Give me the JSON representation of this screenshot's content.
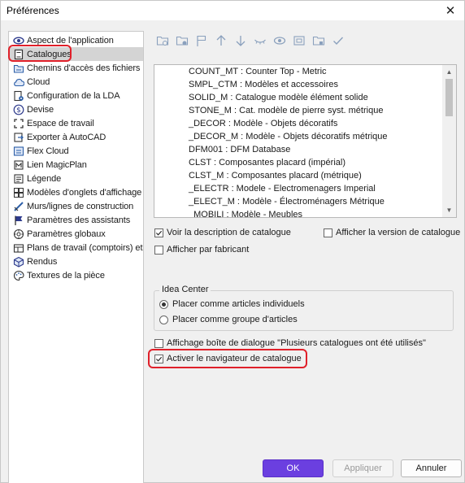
{
  "window": {
    "title": "Préférences",
    "close_glyph": "✕"
  },
  "sidebar": {
    "items": [
      {
        "label": "Aspect de l'application",
        "icon": "eye-icon"
      },
      {
        "label": "Catalogues",
        "icon": "book-icon",
        "selected": true
      },
      {
        "label": "Chemins d'accès des fichiers",
        "icon": "folder-path-icon"
      },
      {
        "label": "Cloud",
        "icon": "cloud-icon"
      },
      {
        "label": "Configuration de la LDA",
        "icon": "config-icon"
      },
      {
        "label": "Devise",
        "icon": "currency-icon"
      },
      {
        "label": "Espace de travail",
        "icon": "workspace-icon"
      },
      {
        "label": "Exporter à AutoCAD",
        "icon": "export-icon"
      },
      {
        "label": "Flex Cloud",
        "icon": "flex-cloud-icon"
      },
      {
        "label": "Lien MagicPlan",
        "icon": "link-icon"
      },
      {
        "label": "Légende",
        "icon": "legend-icon"
      },
      {
        "label": "Modèles d'onglets d'affichage",
        "icon": "tabs-icon"
      },
      {
        "label": "Murs/lignes de construction",
        "icon": "walls-icon"
      },
      {
        "label": "Paramètres des assistants",
        "icon": "flag-icon"
      },
      {
        "label": "Paramètres globaux",
        "icon": "globe-icon"
      },
      {
        "label": "Plans de travail (comptoirs) et g",
        "icon": "countertop-icon"
      },
      {
        "label": "Rendus",
        "icon": "render-icon"
      },
      {
        "label": "Textures de la pièce",
        "icon": "palette-icon"
      }
    ]
  },
  "toolbar": {
    "icons": [
      "add-folder-icon",
      "folder-settings-icon",
      "flag-icon",
      "arrow-up-icon",
      "arrow-down-icon",
      "eye-closed-icon",
      "eye-icon",
      "window-icon",
      "folder-gear-icon",
      "check-icon"
    ]
  },
  "catalog_list": {
    "rows": [
      "COUNT_MT : Counter Top - Metric",
      "SMPL_CTM : Modèles et accessoires",
      "SOLID_M : Catalogue modèle élément solide",
      "STONE_M : Cat. modèle de pierre syst. métrique",
      "_DECOR : Modèle - Objets décoratifs",
      "_DECOR_M : Modèle - Objets décoratifs métrique",
      "DFM001 : DFM Database",
      "CLST : Composantes placard (impérial)",
      "CLST_M : Composantes placard (métrique)",
      "_ELECTR : Modele - Electromenagers Imperial",
      "_ELECT_M : Modèle - Électroménagers Métrique",
      "_MOBILI : Modèle - Meubles"
    ]
  },
  "options": {
    "show_description": {
      "label": "Voir la description de catalogue",
      "checked": true
    },
    "show_version": {
      "label": "Afficher la version de catalogue",
      "checked": false
    },
    "by_manufacturer": {
      "label": "Afficher par fabricant",
      "checked": false
    },
    "multi_catalog_dialog": {
      "label": "Affichage boîte de dialogue \"Plusieurs catalogues ont été utilisés\"",
      "checked": false
    },
    "catalog_browser": {
      "label": "Activer le navigateur de catalogue",
      "checked": true
    }
  },
  "idea_center": {
    "title": "Idea Center",
    "individual": {
      "label": "Placer comme articles individuels",
      "selected": true
    },
    "group": {
      "label": "Placer comme groupe d'articles",
      "selected": false
    }
  },
  "buttons": {
    "ok": "OK",
    "apply": "Appliquer",
    "cancel": "Annuler"
  },
  "colors": {
    "accent": "#6b3fe0",
    "highlight": "#e0202a",
    "selected_row": "#d4d4d4"
  }
}
